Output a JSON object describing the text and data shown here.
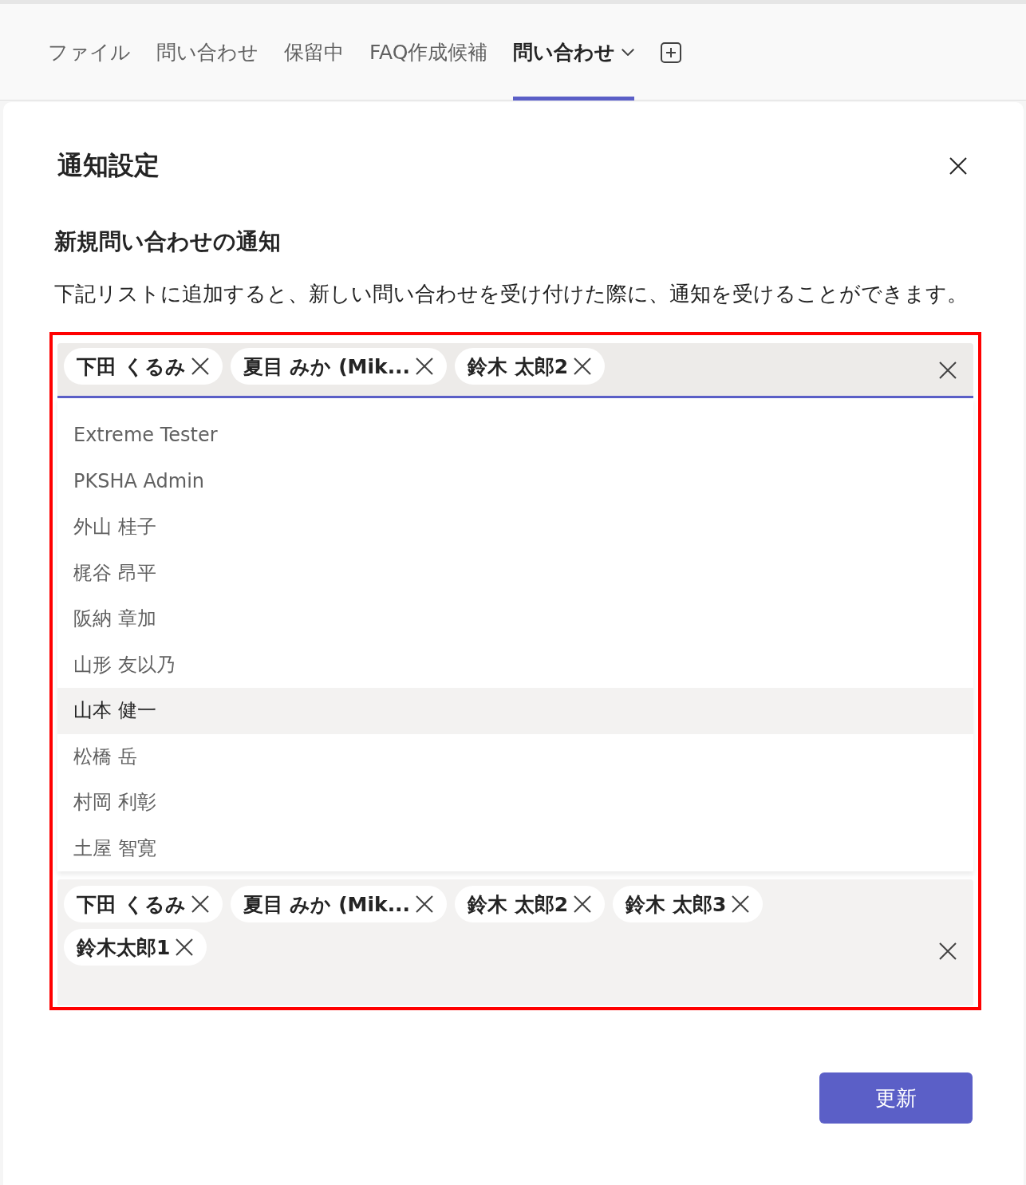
{
  "tabs": [
    {
      "label": "ファイル",
      "selected": false,
      "dropdown": false
    },
    {
      "label": "問い合わせ",
      "selected": false,
      "dropdown": false
    },
    {
      "label": "保留中",
      "selected": false,
      "dropdown": false
    },
    {
      "label": "FAQ作成候補",
      "selected": false,
      "dropdown": false
    },
    {
      "label": "問い合わせ",
      "selected": true,
      "dropdown": true
    }
  ],
  "dialog": {
    "title": "通知設定",
    "section_title": "新規問い合わせの通知",
    "description": "下記リストに追加すると、新しい問い合わせを受け付けた際に、通知を受けることができます。",
    "picker": {
      "chips": [
        "下田 くるみ",
        "夏目 みか (Mik...",
        "鈴木 太郎2"
      ],
      "suggestions": [
        {
          "name": "Extreme Tester",
          "selected": false
        },
        {
          "name": "PKSHA Admin",
          "selected": false
        },
        {
          "name": "外山 桂子",
          "selected": false
        },
        {
          "name": "梶谷 昂平",
          "selected": false
        },
        {
          "name": "阪納 章加",
          "selected": false
        },
        {
          "name": "山形 友以乃",
          "selected": false
        },
        {
          "name": "山本 健一",
          "selected": true
        },
        {
          "name": "松橋 岳",
          "selected": false
        },
        {
          "name": "村岡 利彰",
          "selected": false
        },
        {
          "name": "土屋 智寛",
          "selected": false
        }
      ]
    },
    "selected_field": {
      "chips": [
        "下田 くるみ",
        "夏目 みか (Mik...",
        "鈴木 太郎2",
        "鈴木 太郎3",
        "鈴木太郎1"
      ]
    },
    "update_button": "更新"
  }
}
